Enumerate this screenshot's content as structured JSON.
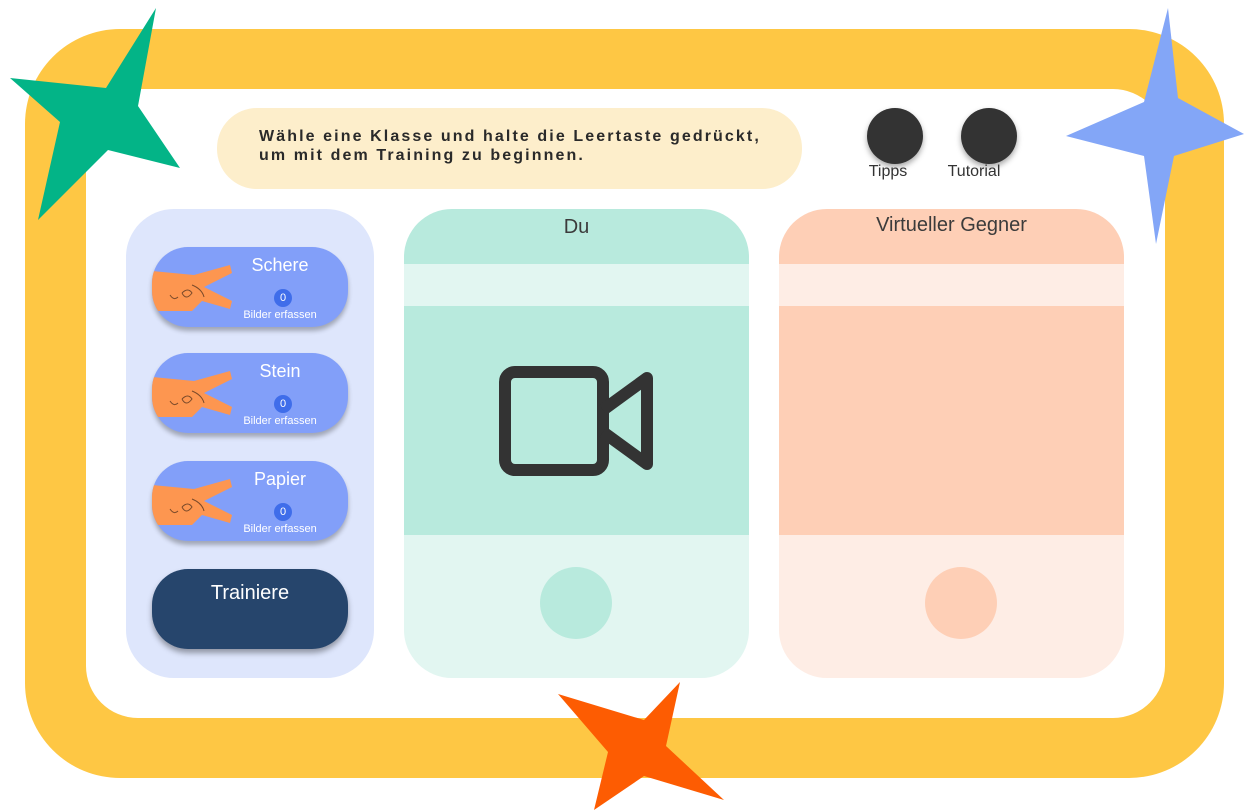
{
  "instruction": {
    "line1": "Wähle eine Klasse und halte die Leertaste gedrückt,",
    "line2": "um mit dem Training zu beginnen."
  },
  "top_buttons": [
    {
      "label": "Tipps"
    },
    {
      "label": "Tutorial"
    }
  ],
  "classes": [
    {
      "name": "Schere",
      "count": "0",
      "action": "Bilder erfassen"
    },
    {
      "name": "Stein",
      "count": "0",
      "action": "Bilder erfassen"
    },
    {
      "name": "Papier",
      "count": "0",
      "action": "Bilder erfassen"
    }
  ],
  "train_button": {
    "label": "Trainiere"
  },
  "player_panel": {
    "title": "Du",
    "icon": "video-camera-icon"
  },
  "opponent_panel": {
    "title": "Virtueller Gegner"
  },
  "colors": {
    "frame": "#fec744",
    "class_button": "#829ff9",
    "train_button": "#26456c",
    "player_panel": "#b8eadd",
    "opponent_panel": "#fecfb6",
    "star_green": "#03b487",
    "star_blue": "#83a6f7",
    "star_orange": "#fd5c02"
  }
}
